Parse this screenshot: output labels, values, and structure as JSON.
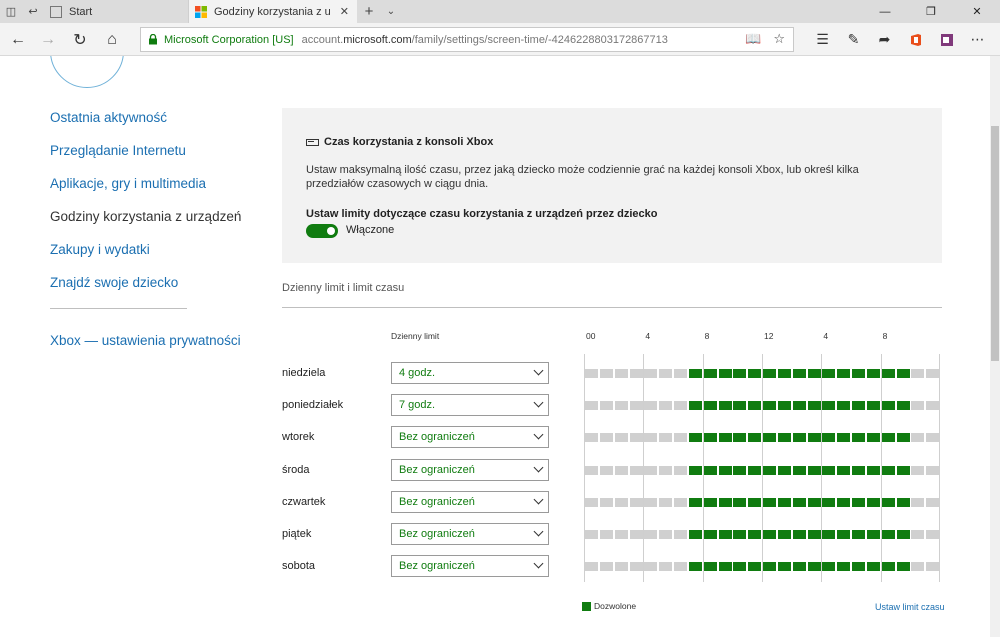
{
  "browser": {
    "tabs": [
      {
        "title": "Start"
      },
      {
        "title": "Godziny korzystania z u",
        "active": true
      }
    ],
    "address": {
      "ev_name": "Microsoft Corporation [US]",
      "url_prefix": "account.",
      "url_domain": "microsoft.com",
      "url_path": "/family/settings/screen-time/-4246228803172867713"
    }
  },
  "sidebar": {
    "items": [
      {
        "label": "Ostatnia aktywność"
      },
      {
        "label": "Przeglądanie Internetu"
      },
      {
        "label": "Aplikacje, gry i multimedia"
      },
      {
        "label": "Godziny korzystania z urządzeń",
        "current": true
      },
      {
        "label": "Zakupy i wydatki"
      },
      {
        "label": "Znajdź swoje dziecko"
      }
    ],
    "secondary": {
      "label": "Xbox — ustawienia prywatności"
    }
  },
  "panel": {
    "title": "Czas korzystania z konsoli Xbox",
    "description": "Ustaw maksymalną ilość czasu, przez jaką dziecko może codziennie grać na każdej konsoli Xbox, lub określ kilka przedziałów czasowych w ciągu dnia.",
    "toggle_heading": "Ustaw limity dotyczące czasu korzystania z urządzeń przez dziecko",
    "toggle_state": "Włączone",
    "toggle_on": true
  },
  "schedule": {
    "section_title": "Dzienny limit i limit czasu",
    "limit_header": "Dzienny limit",
    "hour_labels": [
      "00",
      "4",
      "8",
      "12",
      "4",
      "8"
    ],
    "allowed_from_hour": 7,
    "allowed_to_hour": 22,
    "days": [
      {
        "name": "niedziela",
        "limit": "4 godz."
      },
      {
        "name": "poniedziałek",
        "limit": "7 godz."
      },
      {
        "name": "wtorek",
        "limit": "Bez ograniczeń"
      },
      {
        "name": "środa",
        "limit": "Bez ograniczeń"
      },
      {
        "name": "czwartek",
        "limit": "Bez ograniczeń"
      },
      {
        "name": "piątek",
        "limit": "Bez ograniczeń"
      },
      {
        "name": "sobota",
        "limit": "Bez ograniczeń"
      }
    ],
    "legend_allowed": "Dozwolone",
    "set_time_link": "Ustaw limit czasu"
  },
  "colors": {
    "accent_green": "#107c10",
    "link_blue": "#1b6fb1"
  }
}
